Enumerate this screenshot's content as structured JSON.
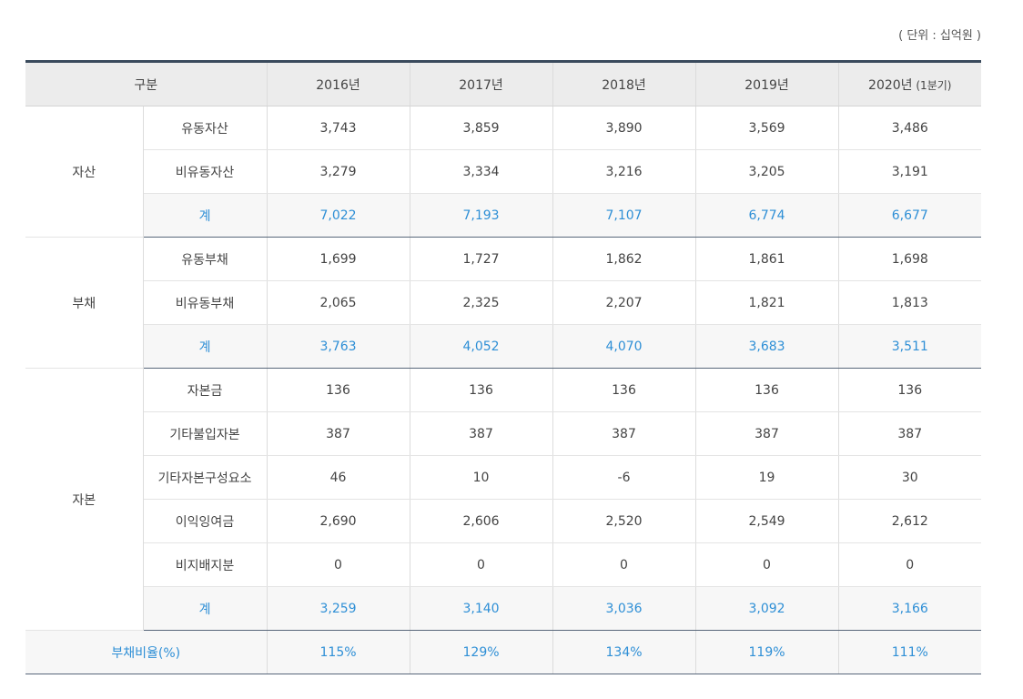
{
  "unit_label": "( 단위 : 십억원 )",
  "header": {
    "category": "구분",
    "years": [
      {
        "label": "2016년",
        "suffix": ""
      },
      {
        "label": "2017년",
        "suffix": ""
      },
      {
        "label": "2018년",
        "suffix": ""
      },
      {
        "label": "2019년",
        "suffix": ""
      },
      {
        "label": "2020년",
        "suffix": " (1분기)"
      }
    ]
  },
  "groups": [
    {
      "name": "자산",
      "rows": [
        {
          "label": "유동자산",
          "values": [
            "3,743",
            "3,859",
            "3,890",
            "3,569",
            "3,486"
          ],
          "total": false
        },
        {
          "label": "비유동자산",
          "values": [
            "3,279",
            "3,334",
            "3,216",
            "3,205",
            "3,191"
          ],
          "total": false
        },
        {
          "label": "계",
          "values": [
            "7,022",
            "7,193",
            "7,107",
            "6,774",
            "6,677"
          ],
          "total": true
        }
      ]
    },
    {
      "name": "부채",
      "rows": [
        {
          "label": "유동부채",
          "values": [
            "1,699",
            "1,727",
            "1,862",
            "1,861",
            "1,698"
          ],
          "total": false
        },
        {
          "label": "비유동부채",
          "values": [
            "2,065",
            "2,325",
            "2,207",
            "1,821",
            "1,813"
          ],
          "total": false
        },
        {
          "label": "계",
          "values": [
            "3,763",
            "4,052",
            "4,070",
            "3,683",
            "3,511"
          ],
          "total": true
        }
      ]
    },
    {
      "name": "자본",
      "rows": [
        {
          "label": "자본금",
          "values": [
            "136",
            "136",
            "136",
            "136",
            "136"
          ],
          "total": false
        },
        {
          "label": "기타불입자본",
          "values": [
            "387",
            "387",
            "387",
            "387",
            "387"
          ],
          "total": false
        },
        {
          "label": "기타자본구성요소",
          "values": [
            "46",
            "10",
            "-6",
            "19",
            "30"
          ],
          "total": false
        },
        {
          "label": "이익잉여금",
          "values": [
            "2,690",
            "2,606",
            "2,520",
            "2,549",
            "2,612"
          ],
          "total": false
        },
        {
          "label": "비지배지분",
          "values": [
            "0",
            "0",
            "0",
            "0",
            "0"
          ],
          "total": false
        },
        {
          "label": "계",
          "values": [
            "3,259",
            "3,140",
            "3,036",
            "3,092",
            "3,166"
          ],
          "total": true
        }
      ]
    }
  ],
  "ratio": {
    "label": "부채비율(%)",
    "values": [
      "115%",
      "129%",
      "134%",
      "119%",
      "111%"
    ]
  },
  "colors": {
    "accent_blue": "#2e8fd6",
    "header_bg": "#ececec",
    "header_top_border": "#3a4a5c",
    "group_divider": "#58677a"
  }
}
